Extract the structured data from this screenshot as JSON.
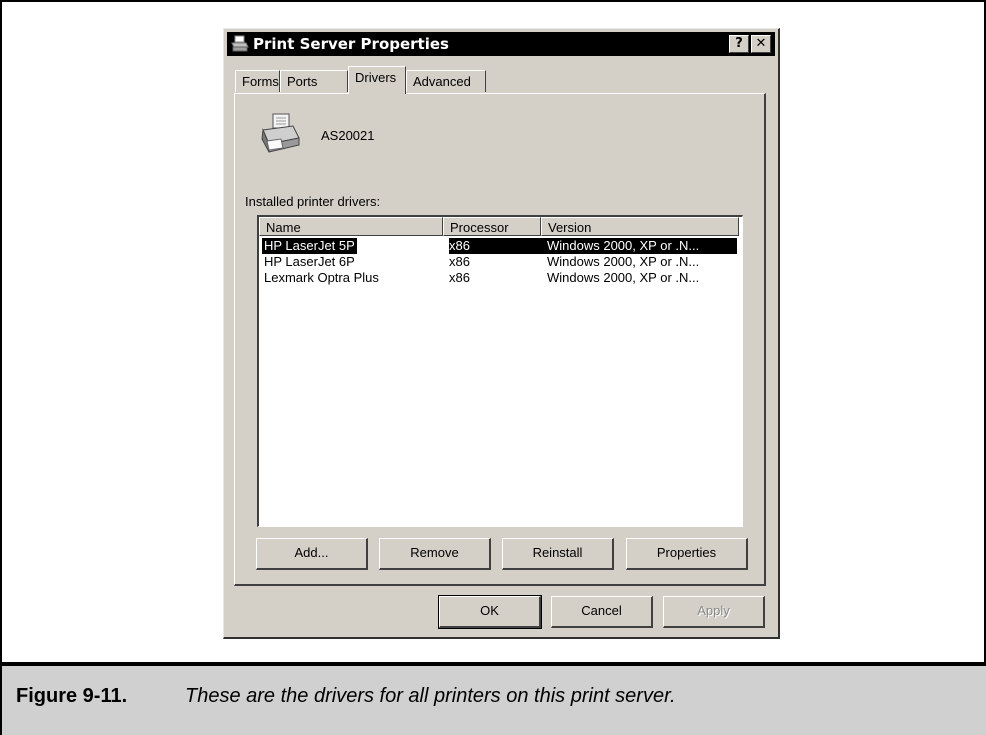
{
  "dialog": {
    "title": "Print Server Properties",
    "help_glyph": "?",
    "close_glyph": "✕",
    "tabs": [
      {
        "label": "Forms"
      },
      {
        "label": "Ports"
      },
      {
        "label": "Drivers"
      },
      {
        "label": "Advanced"
      }
    ],
    "active_tab": "Drivers",
    "server_name": "AS20021",
    "drivers_label": "Installed printer drivers:",
    "columns": [
      "Name",
      "Processor",
      "Version"
    ],
    "rows": [
      {
        "name": "HP LaserJet 5P",
        "processor": "x86",
        "version": "Windows 2000, XP or .N...",
        "selected": true
      },
      {
        "name": "HP LaserJet 6P",
        "processor": "x86",
        "version": "Windows 2000, XP or .N...",
        "selected": false
      },
      {
        "name": "Lexmark Optra Plus",
        "processor": "x86",
        "version": "Windows 2000, XP or .N...",
        "selected": false
      }
    ],
    "buttons": {
      "add": "Add...",
      "remove": "Remove",
      "reinstall": "Reinstall",
      "properties": "Properties",
      "ok": "OK",
      "cancel": "Cancel",
      "apply": "Apply"
    },
    "icons": {
      "title": "printer-icon",
      "server": "printer-icon"
    }
  },
  "caption": {
    "number": "Figure 9-11.",
    "text": "These are the drivers for all printers on this print server."
  }
}
